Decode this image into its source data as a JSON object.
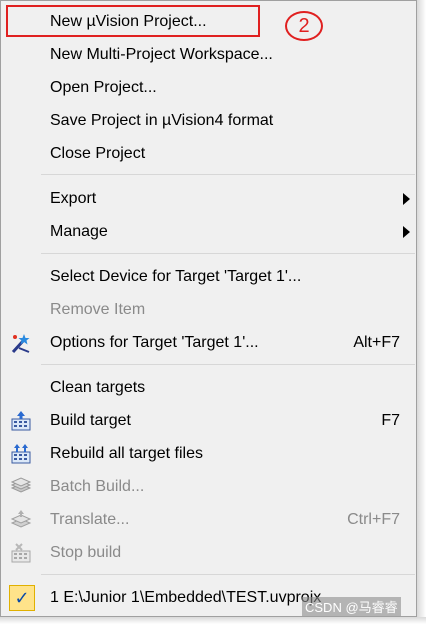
{
  "annotation": {
    "step_number": "2"
  },
  "menu": {
    "new_project": "New µVision Project...",
    "new_multi_project": "New Multi-Project Workspace...",
    "open_project": "Open Project...",
    "save_project": "Save Project in µVision4 format",
    "close_project": "Close Project",
    "export": "Export",
    "manage": "Manage",
    "select_device": "Select Device for Target 'Target 1'...",
    "remove_item": "Remove Item",
    "options_target": "Options for Target 'Target 1'...",
    "options_shortcut": "Alt+F7",
    "clean_targets": "Clean targets",
    "build_target": "Build target",
    "build_shortcut": "F7",
    "rebuild_all": "Rebuild all target files",
    "batch_build": "Batch Build...",
    "translate": "Translate...",
    "translate_shortcut": "Ctrl+F7",
    "stop_build": "Stop build",
    "recent_project": "1 E:\\Junior 1\\Embedded\\TEST.uvprojx"
  },
  "watermark": "CSDN @马睿睿",
  "colors": {
    "menu_bg": "#f0f0f0",
    "annotation_red": "#e02020",
    "disabled_text": "#8a8a8a"
  }
}
